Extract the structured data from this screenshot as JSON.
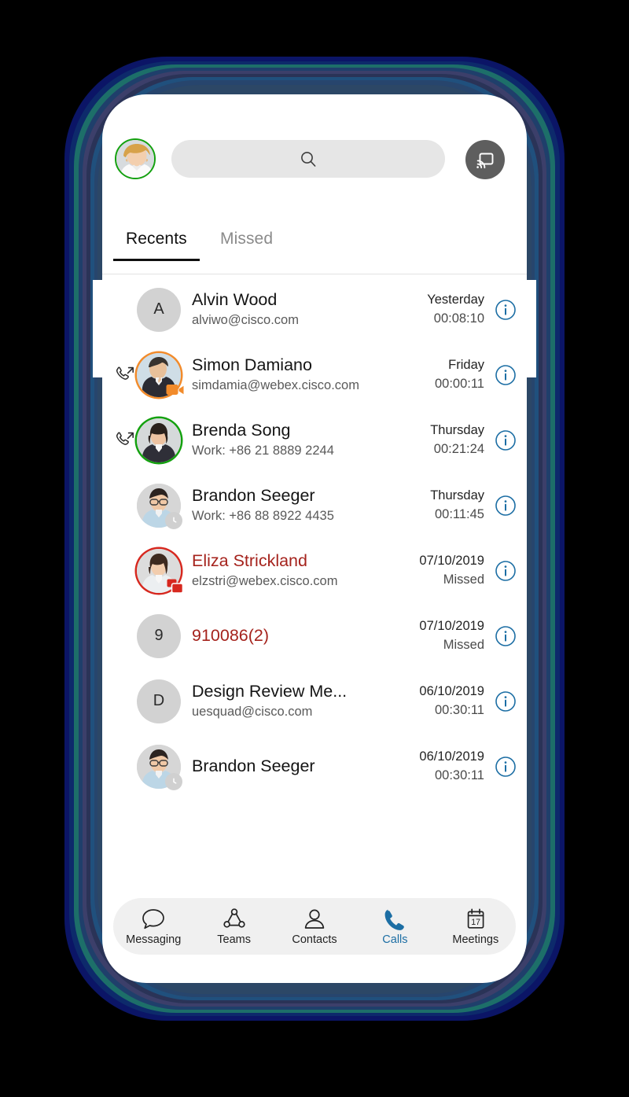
{
  "app": {
    "screen_title": "Calls",
    "colors": {
      "accent": "#1c6ea4",
      "missed": "#a5231d",
      "available": "#13a10e",
      "presenting": "#f28b2b",
      "dnd": "#d7281f",
      "frame_outer": "#0b1566",
      "frame_inner": "#2c4766"
    }
  },
  "header": {
    "avatar_name": "self-avatar",
    "avatar_status": "available",
    "search_placeholder": "",
    "search_value": "",
    "search_icon": "search-icon",
    "cast_icon": "cast-screen-icon"
  },
  "tabs": [
    {
      "label": "Recents",
      "active": true
    },
    {
      "label": "Missed",
      "active": false
    }
  ],
  "calls": [
    {
      "name": "Alvin Wood",
      "subtitle": "alviwo@cisco.com",
      "date": "Yesterday",
      "duration": "00:08:10",
      "missed": false,
      "avatar_type": "initial",
      "initial": "A",
      "status_ring": "none",
      "status_badge": "none",
      "direction_icon": "none"
    },
    {
      "name": "Simon Damiano",
      "subtitle": "simdamia@webex.cisco.com",
      "date": "Friday",
      "duration": "00:00:11",
      "missed": false,
      "avatar_type": "photo",
      "initial": "",
      "status_ring": "orange",
      "status_badge": "video-badge",
      "direction_icon": "outgoing-call-icon"
    },
    {
      "name": "Brenda Song",
      "subtitle": "Work: +86 21 8889 2244",
      "date": "Thursday",
      "duration": "00:21:24",
      "missed": false,
      "avatar_type": "photo",
      "initial": "",
      "status_ring": "green",
      "status_badge": "none",
      "direction_icon": "outgoing-call-icon"
    },
    {
      "name": "Brandon Seeger",
      "subtitle": "Work: +86 88 8922 4435",
      "date": "Thursday",
      "duration": "00:11:45",
      "missed": false,
      "avatar_type": "photo",
      "initial": "",
      "status_ring": "none",
      "status_badge": "clock-badge",
      "direction_icon": "none"
    },
    {
      "name": "Eliza Strickland",
      "subtitle": "elzstri@webex.cisco.com",
      "date": "07/10/2019",
      "duration": "Missed",
      "missed": true,
      "avatar_type": "photo",
      "initial": "",
      "status_ring": "red",
      "status_badge": "share-badge",
      "direction_icon": "none"
    },
    {
      "name": "910086(2)",
      "subtitle": "",
      "date": "07/10/2019",
      "duration": "Missed",
      "missed": true,
      "avatar_type": "initial",
      "initial": "9",
      "status_ring": "none",
      "status_badge": "none",
      "direction_icon": "none"
    },
    {
      "name": "Design Review Me...",
      "subtitle": "uesquad@cisco.com",
      "date": "06/10/2019",
      "duration": "00:30:11",
      "missed": false,
      "avatar_type": "initial",
      "initial": "D",
      "status_ring": "none",
      "status_badge": "none",
      "direction_icon": "none"
    },
    {
      "name": "Brandon Seeger",
      "subtitle": "",
      "date": "06/10/2019",
      "duration": "00:30:11",
      "missed": false,
      "avatar_type": "photo",
      "initial": "",
      "status_ring": "none",
      "status_badge": "clock-badge",
      "direction_icon": "none"
    }
  ],
  "info_button_label": "i",
  "bottom_nav": [
    {
      "label": "Messaging",
      "icon": "chat-bubble-icon",
      "active": false
    },
    {
      "label": "Teams",
      "icon": "teams-icon",
      "active": false
    },
    {
      "label": "Contacts",
      "icon": "person-icon",
      "active": false
    },
    {
      "label": "Calls",
      "icon": "phone-icon",
      "active": true
    },
    {
      "label": "Meetings",
      "icon": "calendar-icon",
      "active": false,
      "calendar_day": "17"
    }
  ]
}
